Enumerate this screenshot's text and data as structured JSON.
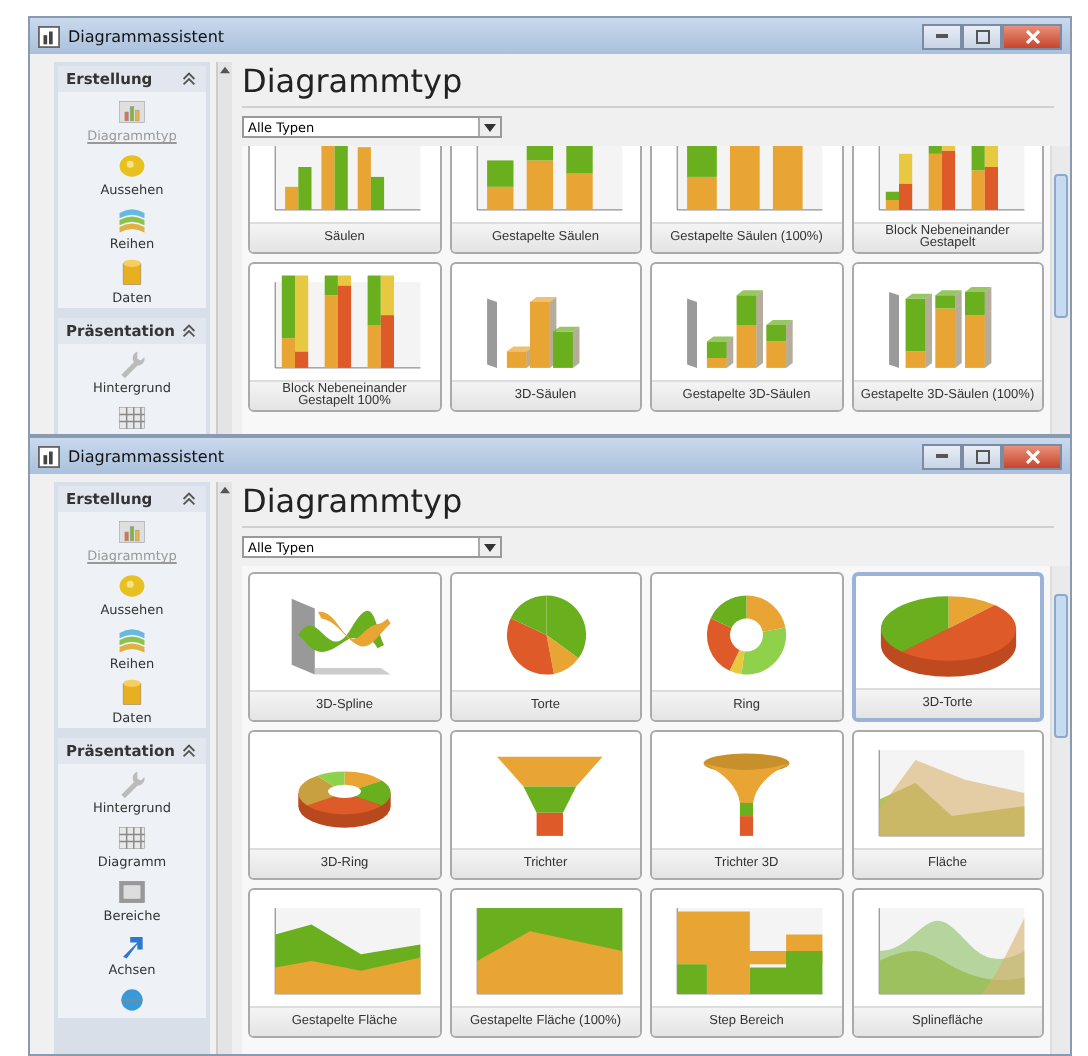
{
  "windows": [
    {
      "title": "Diagrammassistent",
      "sections": [
        {
          "title": "Erstellung",
          "items": [
            {
              "label": "Diagrammtyp",
              "selected": true
            },
            {
              "label": "Aussehen",
              "selected": false
            },
            {
              "label": "Reihen",
              "selected": false
            },
            {
              "label": "Daten",
              "selected": false
            }
          ]
        },
        {
          "title": "Präsentation",
          "items": [
            {
              "label": "Hintergrund",
              "selected": false
            },
            {
              "selected": false
            }
          ]
        }
      ],
      "heading": "Diagrammtyp",
      "filter": "Alle Typen",
      "tiles": [
        {
          "label": "Säulen",
          "kind": "bars",
          "selected": false
        },
        {
          "label": "Gestapelte Säulen",
          "kind": "stacked",
          "selected": false
        },
        {
          "label": "Gestapelte Säulen (100%)",
          "kind": "stacked100",
          "selected": false
        },
        {
          "label": "Block Nebeneinander Gestapelt",
          "kind": "block",
          "selected": false
        },
        {
          "label": "Block Nebeneinander Gestapelt 100%",
          "kind": "block100",
          "selected": false
        },
        {
          "label": "3D-Säulen",
          "kind": "bars3d",
          "selected": false
        },
        {
          "label": "Gestapelte 3D-Säulen",
          "kind": "stacked3d",
          "selected": false
        },
        {
          "label": "Gestapelte 3D-Säulen (100%)",
          "kind": "stacked3d100",
          "selected": false
        }
      ]
    },
    {
      "title": "Diagrammassistent",
      "sections": [
        {
          "title": "Erstellung",
          "items": [
            {
              "label": "Diagrammtyp",
              "selected": true
            },
            {
              "label": "Aussehen",
              "selected": false
            },
            {
              "label": "Reihen",
              "selected": false
            },
            {
              "label": "Daten",
              "selected": false
            }
          ]
        },
        {
          "title": "Präsentation",
          "items": [
            {
              "label": "Hintergrund",
              "selected": false
            },
            {
              "label": "Diagramm",
              "selected": false
            },
            {
              "label": "Bereiche",
              "selected": false
            },
            {
              "label": "Achsen",
              "selected": false
            },
            {
              "selected": false
            }
          ]
        }
      ],
      "heading": "Diagrammtyp",
      "filter": "Alle Typen",
      "tiles": [
        {
          "label": "3D-Spline",
          "kind": "spline3d",
          "selected": false
        },
        {
          "label": "Torte",
          "kind": "pie",
          "selected": false
        },
        {
          "label": "Ring",
          "kind": "ring",
          "selected": false
        },
        {
          "label": "3D-Torte",
          "kind": "pie3d",
          "selected": true
        },
        {
          "label": "3D-Ring",
          "kind": "ring3d",
          "selected": false
        },
        {
          "label": "Trichter",
          "kind": "funnel",
          "selected": false
        },
        {
          "label": "Trichter 3D",
          "kind": "funnel3d",
          "selected": false
        },
        {
          "label": "Fläche",
          "kind": "area",
          "selected": false
        },
        {
          "label": "Gestapelte Fläche",
          "kind": "stackedarea",
          "selected": false
        },
        {
          "label": "Gestapelte Fläche (100%)",
          "kind": "stackedarea100",
          "selected": false
        },
        {
          "label": "Step Bereich",
          "kind": "steparea",
          "selected": false
        },
        {
          "label": "Splinefläche",
          "kind": "splinearea",
          "selected": false
        }
      ]
    }
  ]
}
